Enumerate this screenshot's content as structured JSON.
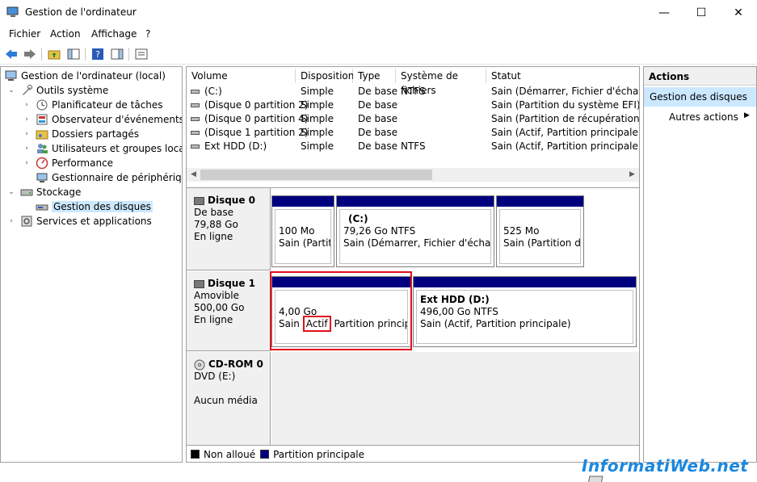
{
  "window": {
    "title": "Gestion de l'ordinateur",
    "minimize": "—",
    "maximize": "☐",
    "close": "✕"
  },
  "menu": [
    "Fichier",
    "Action",
    "Affichage",
    "?"
  ],
  "tree": {
    "root": "Gestion de l'ordinateur (local)",
    "system_tools": "Outils système",
    "task_scheduler": "Planificateur de tâches",
    "event_viewer": "Observateur d'événements",
    "shared_folders": "Dossiers partagés",
    "local_users": "Utilisateurs et groupes locaux",
    "performance": "Performance",
    "device_manager": "Gestionnaire de périphériques",
    "storage": "Stockage",
    "disk_management": "Gestion des disques",
    "services": "Services et applications"
  },
  "volumes": {
    "columns": [
      "Volume",
      "Disposition",
      "Type",
      "Système de fichiers",
      "Statut"
    ],
    "rows": [
      {
        "volume": "(C:)",
        "layout": "Simple",
        "type": "De base",
        "fs": "NTFS",
        "status": "Sain (Démarrer, Fichier d'échange, "
      },
      {
        "volume": "(Disque 0 partition 2)",
        "layout": "Simple",
        "type": "De base",
        "fs": "",
        "status": "Sain (Partition du système EFI)"
      },
      {
        "volume": "(Disque 0 partition 4)",
        "layout": "Simple",
        "type": "De base",
        "fs": "",
        "status": "Sain (Partition de récupération)"
      },
      {
        "volume": "(Disque 1 partition 2)",
        "layout": "Simple",
        "type": "De base",
        "fs": "",
        "status": "Sain (Actif, Partition principale)"
      },
      {
        "volume": "Ext HDD (D:)",
        "layout": "Simple",
        "type": "De base",
        "fs": "NTFS",
        "status": "Sain (Actif, Partition principale)"
      }
    ]
  },
  "disks": {
    "disk0": {
      "name": "Disque 0",
      "type": "De base",
      "size": "79,88 Go",
      "state": "En ligne",
      "parts": [
        {
          "title": "",
          "size": "100 Mo",
          "status": "Sain (Partiti"
        },
        {
          "title": "(C:)",
          "size": "79,26 Go NTFS",
          "status": "Sain (Démarrer, Fichier d'échange,"
        },
        {
          "title": "",
          "size": "525 Mo",
          "status": "Sain (Partition de r"
        }
      ]
    },
    "disk1": {
      "name": "Disque 1",
      "type": "Amovible",
      "size": "500,00 Go",
      "state": "En ligne",
      "parts": [
        {
          "title": "",
          "size": "4,00 Go",
          "status_pre": "Sain",
          "status_active": "Actif",
          "status_post": "Partition principale"
        },
        {
          "title": "Ext HDD  (D:)",
          "size": "496,00 Go NTFS",
          "status": "Sain (Actif, Partition principale)"
        }
      ]
    },
    "cdrom0": {
      "name": "CD-ROM 0",
      "type": "DVD (E:)",
      "media": "Aucun média"
    }
  },
  "legend": {
    "unallocated": "Non alloué",
    "primary": "Partition principale"
  },
  "actions": {
    "header": "Actions",
    "selected": "Gestion des disques",
    "more": "Autres actions"
  },
  "watermark": "InformatiWeb.net",
  "colors": {
    "primary_partition": "#00007f",
    "unallocated": "#000000",
    "highlight": "#e0101e",
    "selection": "#cce8ff"
  }
}
